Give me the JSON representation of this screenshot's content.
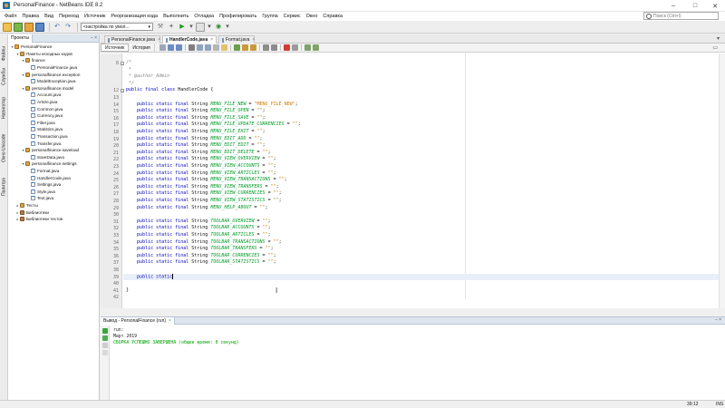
{
  "window": {
    "title": "PersonalFinance - NetBeans IDE 8.2"
  },
  "menu": [
    "Файл",
    "Правка",
    "Вид",
    "Переход",
    "Источник",
    "Реорганизация кода",
    "Выполнить",
    "Отладка",
    "Профилировать",
    "Группа",
    "Сервис",
    "Окно",
    "Справка"
  ],
  "search": {
    "placeholder": "Поиск (Ctrl+I)"
  },
  "toolbar": {
    "config": "<настройка по умол...",
    "dropdown_arrow": "▾"
  },
  "side_tabs": [
    "Файлы",
    "Службы",
    "Навигатор",
    "Окно Unicode",
    "Палитра"
  ],
  "projects": {
    "tab_label": "Проекты",
    "tree": [
      {
        "label": "PersonalFinance",
        "icon": "project-icon"
      },
      {
        "label": "Пакеты исходных кодов",
        "icon": "source-packages-icon"
      },
      {
        "label": "finance",
        "icon": "package-icon"
      },
      {
        "label": "PersonalFinance.java",
        "icon": "java-file-icon"
      },
      {
        "label": "personalfinance.exception",
        "icon": "package-icon"
      },
      {
        "label": "ModelException.java",
        "icon": "java-file-icon"
      },
      {
        "label": "personalfinance.model",
        "icon": "package-icon"
      },
      {
        "label": "Account.java",
        "icon": "java-file-icon"
      },
      {
        "label": "Article.java",
        "icon": "java-file-icon"
      },
      {
        "label": "Common.java",
        "icon": "java-file-icon"
      },
      {
        "label": "Currency.java",
        "icon": "java-file-icon"
      },
      {
        "label": "Filter.java",
        "icon": "java-file-icon"
      },
      {
        "label": "Statistics.java",
        "icon": "java-file-icon"
      },
      {
        "label": "Transaction.java",
        "icon": "java-file-icon"
      },
      {
        "label": "Transfer.java",
        "icon": "java-file-icon"
      },
      {
        "label": "personalfinance.saveload",
        "icon": "package-icon"
      },
      {
        "label": "SaveData.java",
        "icon": "java-file-icon"
      },
      {
        "label": "personalfinance.settings",
        "icon": "package-icon"
      },
      {
        "label": "Format.java",
        "icon": "java-file-icon"
      },
      {
        "label": "HandlerCode.java",
        "icon": "java-file-icon"
      },
      {
        "label": "Settings.java",
        "icon": "java-file-icon"
      },
      {
        "label": "Style.java",
        "icon": "java-file-icon"
      },
      {
        "label": "Text.java",
        "icon": "java-file-icon"
      },
      {
        "label": "Тесты",
        "icon": "test-packages-icon"
      },
      {
        "label": "Библиотеки",
        "icon": "libraries-icon"
      },
      {
        "label": "Библиотеки тестов",
        "icon": "test-libraries-icon"
      }
    ]
  },
  "editor": {
    "tabs": [
      {
        "label": "PersonalFinance.java",
        "close": "×"
      },
      {
        "label": "HandlerCode.java",
        "close": "×"
      },
      {
        "label": "Format.java",
        "close": "×"
      }
    ],
    "view_buttons": {
      "source": "Источник",
      "history": "История"
    },
    "lines": [
      {
        "n": "8",
        "parts": [
          [
            "cmt",
            "/*"
          ]
        ]
      },
      {
        "n": "",
        "parts": [
          [
            "cmt",
            " *"
          ]
        ]
      },
      {
        "n": "",
        "parts": [
          [
            "cmt",
            " * @author Admin"
          ]
        ]
      },
      {
        "n": "",
        "parts": [
          [
            "cmt",
            " */"
          ]
        ]
      },
      {
        "n": "12",
        "parts": [
          [
            "kw",
            "public final class"
          ],
          [
            "",
            " HandlerCode {"
          ]
        ]
      },
      {
        "n": "13",
        "parts": []
      },
      {
        "n": "14",
        "parts": [
          [
            "",
            "    "
          ],
          [
            "kw",
            "public static final"
          ],
          [
            "",
            " String "
          ],
          [
            "fld",
            "MENU_FILE_NEW"
          ],
          [
            "",
            " = "
          ],
          [
            "str",
            "\"MENU_FILE_NEW\""
          ],
          [
            "",
            ";"
          ]
        ]
      },
      {
        "n": "15",
        "parts": [
          [
            "",
            "    "
          ],
          [
            "kw",
            "public static final"
          ],
          [
            "",
            " String "
          ],
          [
            "fld",
            "MENU_FILE_OPEN"
          ],
          [
            "",
            " = "
          ],
          [
            "str",
            "\"\""
          ],
          [
            "",
            ";"
          ]
        ]
      },
      {
        "n": "16",
        "parts": [
          [
            "",
            "    "
          ],
          [
            "kw",
            "public static final"
          ],
          [
            "",
            " String "
          ],
          [
            "fld",
            "MENU_FILE_SAVE"
          ],
          [
            "",
            " = "
          ],
          [
            "str",
            "\"\""
          ],
          [
            "",
            ";"
          ]
        ]
      },
      {
        "n": "17",
        "parts": [
          [
            "",
            "    "
          ],
          [
            "kw",
            "public static final"
          ],
          [
            "",
            " String "
          ],
          [
            "fld",
            "MENU_FILE_UPDATE_CURRENCIES"
          ],
          [
            "",
            " = "
          ],
          [
            "str",
            "\"\""
          ],
          [
            "",
            ";"
          ]
        ]
      },
      {
        "n": "18",
        "parts": [
          [
            "",
            "    "
          ],
          [
            "kw",
            "public static final"
          ],
          [
            "",
            " String "
          ],
          [
            "fld",
            "MENU_FILE_EXIT"
          ],
          [
            "",
            " = "
          ],
          [
            "str",
            "\"\""
          ],
          [
            "",
            ";"
          ]
        ]
      },
      {
        "n": "19",
        "parts": [
          [
            "",
            "    "
          ],
          [
            "kw",
            "public static final"
          ],
          [
            "",
            " String "
          ],
          [
            "fld",
            "MENU_EDIT_ADD"
          ],
          [
            "",
            " = "
          ],
          [
            "str",
            "\"\""
          ],
          [
            "",
            ";"
          ]
        ]
      },
      {
        "n": "20",
        "parts": [
          [
            "",
            "    "
          ],
          [
            "kw",
            "public static final"
          ],
          [
            "",
            " String "
          ],
          [
            "fld",
            "MENU_EDIT_EDIT"
          ],
          [
            "",
            " = "
          ],
          [
            "str",
            "\"\""
          ],
          [
            "",
            ";"
          ]
        ]
      },
      {
        "n": "21",
        "parts": [
          [
            "",
            "    "
          ],
          [
            "kw",
            "public static final"
          ],
          [
            "",
            " String "
          ],
          [
            "fld",
            "MENU_EDIT_DELETE"
          ],
          [
            "",
            " = "
          ],
          [
            "str",
            "\"\""
          ],
          [
            "",
            ";"
          ]
        ]
      },
      {
        "n": "22",
        "parts": [
          [
            "",
            "    "
          ],
          [
            "kw",
            "public static final"
          ],
          [
            "",
            " String "
          ],
          [
            "fld",
            "MENU_VIEW_OVERVIEW"
          ],
          [
            "",
            " = "
          ],
          [
            "str",
            "\"\""
          ],
          [
            "",
            ";"
          ]
        ]
      },
      {
        "n": "23",
        "parts": [
          [
            "",
            "    "
          ],
          [
            "kw",
            "public static final"
          ],
          [
            "",
            " String "
          ],
          [
            "fld",
            "MENU_VIEW_ACCOUNTS"
          ],
          [
            "",
            " = "
          ],
          [
            "str",
            "\"\""
          ],
          [
            "",
            ";"
          ]
        ]
      },
      {
        "n": "24",
        "parts": [
          [
            "",
            "    "
          ],
          [
            "kw",
            "public static final"
          ],
          [
            "",
            " String "
          ],
          [
            "fld",
            "MENU_VIEW_ARTICLES"
          ],
          [
            "",
            " = "
          ],
          [
            "str",
            "\"\""
          ],
          [
            "",
            ";"
          ]
        ]
      },
      {
        "n": "25",
        "parts": [
          [
            "",
            "    "
          ],
          [
            "kw",
            "public static final"
          ],
          [
            "",
            " String "
          ],
          [
            "fld",
            "MENU_VIEW_TRANSACTIONS"
          ],
          [
            "",
            " = "
          ],
          [
            "str",
            "\"\""
          ],
          [
            "",
            ";"
          ]
        ]
      },
      {
        "n": "26",
        "parts": [
          [
            "",
            "    "
          ],
          [
            "kw",
            "public static final"
          ],
          [
            "",
            " String "
          ],
          [
            "fld",
            "MENU_VIEW_TRANSFERS"
          ],
          [
            "",
            " = "
          ],
          [
            "str",
            "\"\""
          ],
          [
            "",
            ";"
          ]
        ]
      },
      {
        "n": "27",
        "parts": [
          [
            "",
            "    "
          ],
          [
            "kw",
            "public static final"
          ],
          [
            "",
            " String "
          ],
          [
            "fld",
            "MENU_VIEW_CURRENCIES"
          ],
          [
            "",
            " = "
          ],
          [
            "str",
            "\"\""
          ],
          [
            "",
            ";"
          ]
        ]
      },
      {
        "n": "28",
        "parts": [
          [
            "",
            "    "
          ],
          [
            "kw",
            "public static final"
          ],
          [
            "",
            " String "
          ],
          [
            "fld",
            "MENU_VIEW_STATISTICS"
          ],
          [
            "",
            " = "
          ],
          [
            "str",
            "\"\""
          ],
          [
            "",
            ";"
          ]
        ]
      },
      {
        "n": "29",
        "parts": [
          [
            "",
            "    "
          ],
          [
            "kw",
            "public static final"
          ],
          [
            "",
            " String "
          ],
          [
            "fld",
            "MENU_HELP_ABOUT"
          ],
          [
            "",
            " = "
          ],
          [
            "str",
            "\"\""
          ],
          [
            "",
            ";"
          ]
        ]
      },
      {
        "n": "30",
        "parts": []
      },
      {
        "n": "31",
        "parts": [
          [
            "",
            "    "
          ],
          [
            "kw",
            "public static final"
          ],
          [
            "",
            " String "
          ],
          [
            "fld",
            "TOOLBAR_OVERVIEW"
          ],
          [
            "",
            " = "
          ],
          [
            "str",
            "\"\""
          ],
          [
            "",
            ";"
          ]
        ]
      },
      {
        "n": "32",
        "parts": [
          [
            "",
            "    "
          ],
          [
            "kw",
            "public static final"
          ],
          [
            "",
            " String "
          ],
          [
            "fld",
            "TOOLBAR_ACCOUNTS"
          ],
          [
            "",
            " = "
          ],
          [
            "str",
            "\"\""
          ],
          [
            "",
            ";"
          ]
        ]
      },
      {
        "n": "33",
        "parts": [
          [
            "",
            "    "
          ],
          [
            "kw",
            "public static final"
          ],
          [
            "",
            " String "
          ],
          [
            "fld",
            "TOOLBAR_ARTICLES"
          ],
          [
            "",
            " = "
          ],
          [
            "str",
            "\"\""
          ],
          [
            "",
            ";"
          ]
        ]
      },
      {
        "n": "34",
        "parts": [
          [
            "",
            "    "
          ],
          [
            "kw",
            "public static final"
          ],
          [
            "",
            " String "
          ],
          [
            "fld",
            "TOOLBAR_TRANSACTIONS"
          ],
          [
            "",
            " = "
          ],
          [
            "str",
            "\"\""
          ],
          [
            "",
            ";"
          ]
        ]
      },
      {
        "n": "35",
        "parts": [
          [
            "",
            "    "
          ],
          [
            "kw",
            "public static final"
          ],
          [
            "",
            " String "
          ],
          [
            "fld",
            "TOOLBAR_TRANSFERS"
          ],
          [
            "",
            " = "
          ],
          [
            "str",
            "\"\""
          ],
          [
            "",
            ";"
          ]
        ]
      },
      {
        "n": "36",
        "parts": [
          [
            "",
            "    "
          ],
          [
            "kw",
            "public static final"
          ],
          [
            "",
            " String "
          ],
          [
            "fld",
            "TOOLBAR_CURRENCIES"
          ],
          [
            "",
            " = "
          ],
          [
            "str",
            "\"\""
          ],
          [
            "",
            ";"
          ]
        ]
      },
      {
        "n": "37",
        "parts": [
          [
            "",
            "    "
          ],
          [
            "kw",
            "public static final"
          ],
          [
            "",
            " String "
          ],
          [
            "fld",
            "TOOLBAR_STATISTICS"
          ],
          [
            "",
            " = "
          ],
          [
            "str",
            "\"\""
          ],
          [
            "",
            ";"
          ]
        ]
      },
      {
        "n": "38",
        "parts": []
      },
      {
        "n": "39",
        "parts": [
          [
            "",
            "    "
          ],
          [
            "kw",
            "public static"
          ]
        ],
        "current": true
      },
      {
        "n": "40",
        "parts": []
      },
      {
        "n": "41",
        "parts": [
          [
            "",
            "}"
          ]
        ]
      },
      {
        "n": "42",
        "parts": []
      }
    ]
  },
  "output": {
    "tab_label": "Вывод - PersonalFinance (run)",
    "lines": [
      {
        "text": "run:",
        "ok": false
      },
      {
        "text": "Март 2019",
        "ok": false
      },
      {
        "text": "СБОРКА УСПЕШНО ЗАВЕРШЕНА (общее время: 0 секунд)",
        "ok": true
      }
    ]
  },
  "status": {
    "position": "39:12",
    "mode": "INS"
  },
  "colors": {
    "keyword": "#0000b4",
    "field": "#009a26",
    "string": "#ce7b00",
    "comment": "#8a8a8a",
    "success": "#00a000"
  }
}
